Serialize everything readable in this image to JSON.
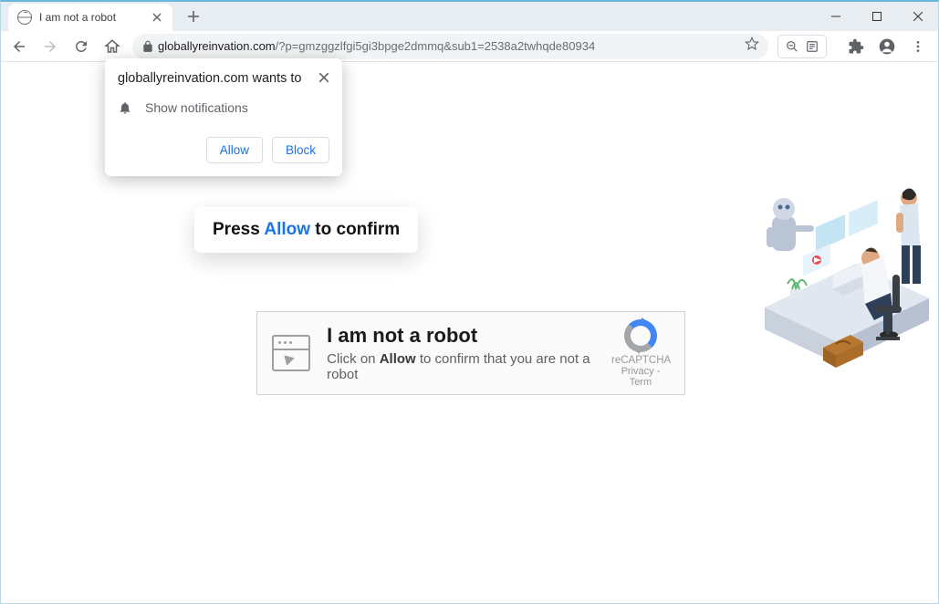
{
  "window": {
    "tab_title": "I am not a robot"
  },
  "address_bar": {
    "host": "globallyreinvation.com",
    "path": "/?p=gmzggzlfgi5gi3bpge2dmmq&sub1=2538a2twhqde80934"
  },
  "permission_prompt": {
    "origin_text": "globallyreinvation.com wants to",
    "option_label": "Show notifications",
    "allow_label": "Allow",
    "block_label": "Block"
  },
  "press_allow_tooltip": {
    "prefix": "Press ",
    "highlight": "Allow",
    "suffix": " to confirm"
  },
  "captcha_card": {
    "title": "I am not a robot",
    "subtitle_prefix": "Click on ",
    "subtitle_bold": "Allow",
    "subtitle_suffix": " to confirm that you are not a robot"
  },
  "recaptcha_badge": {
    "label": "reCAPTCHA",
    "privacy": "Privacy",
    "sep": " - ",
    "terms": "Term"
  }
}
